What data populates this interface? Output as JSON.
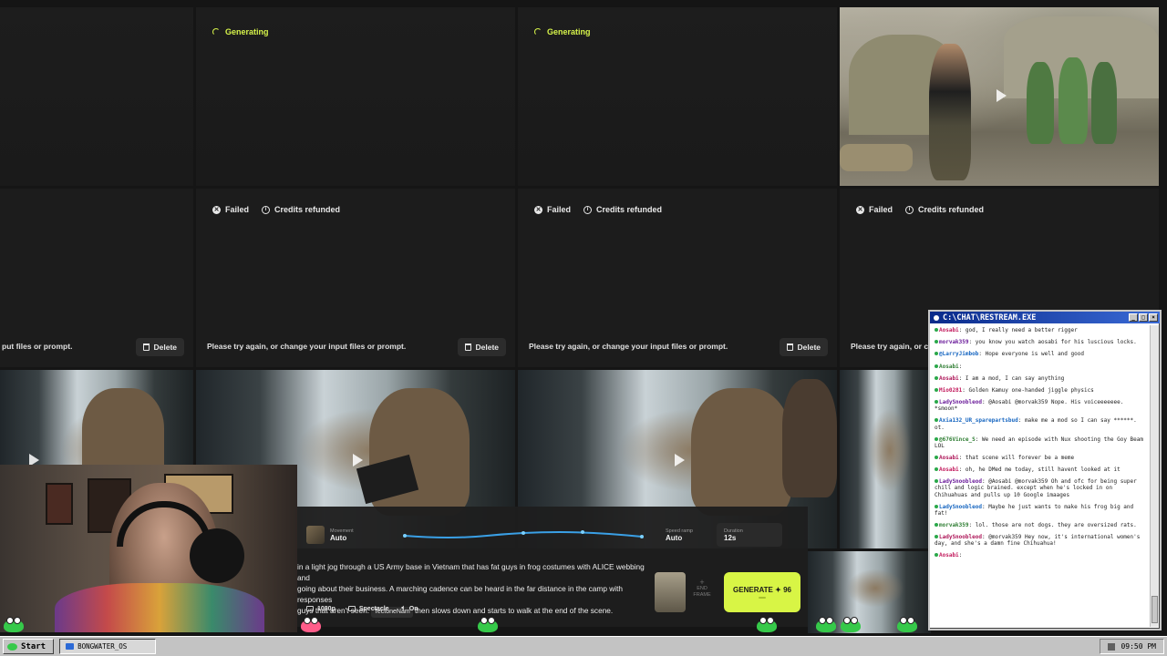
{
  "tiles_row1": {
    "generating_label": "Generating"
  },
  "tiles_row2": {
    "failed_label": "Failed",
    "refunded_label": "Credits refunded",
    "retry_text": "Please try again, or change your input files or prompt.",
    "retry_text_partial_left": "put files or prompt.",
    "retry_text_partial_right": "Please try again, or char",
    "delete_label": "Delete"
  },
  "panel": {
    "movement_label": "Movement",
    "movement_value": "Auto",
    "speed_label": "Speed ramp",
    "speed_value": "Auto",
    "duration_label": "Duration",
    "duration_value": "12s",
    "prompt_line1": "in a light jog through a US Army base in Vietnam that has fat guys in frog costumes with ALICE webbing and",
    "prompt_line2": "going about their business. A marching cadence can be heard in the far distance in the camp with responses",
    "prompt_line3_a": "guys that aren't seen.",
    "prompt_tag": "TectoneNam",
    "prompt_line3_b": "then slows down and starts to walk at the end of the scene.",
    "opt_resolution": "1080p",
    "opt_style": "Spectacle",
    "opt_sound": "On",
    "end_frame": "END FRAME",
    "generate_label": "GENERATE",
    "generate_cost": "96"
  },
  "chat": {
    "title": "C:\\CHAT\\RESTREAM.EXE",
    "messages": [
      {
        "user": "Aosabi",
        "text": "god, I really need a better rigger"
      },
      {
        "user": "morvak359",
        "text": "you know you watch aosabi for his luscious locks."
      },
      {
        "user": "@LarryJimbob",
        "text": "Hope everyone is well and good"
      },
      {
        "user": "Aosabi",
        "text": ""
      },
      {
        "user": "Aosabi",
        "text": "I am a mod, I can say anything"
      },
      {
        "user": "Mio0281",
        "text": "Golden Kamuy one-handed jiggle physics"
      },
      {
        "user": "LadySnoobleod",
        "text": "@Aosabi @morvak359 Nope. His voiceeeeeee. *smoon*"
      },
      {
        "user": "Axia132_UR_sparepartsbud",
        "text": "make me a mod so I can say ******. ot."
      },
      {
        "user": "@676Vince_S",
        "text": "We need an episode with Nux shooting the Goy Beam LOL"
      },
      {
        "user": "Aosabi",
        "text": "that scene will forever be a meme"
      },
      {
        "user": "Aosabi",
        "text": "oh, he DMed me today, still havent looked at it"
      },
      {
        "user": "LadySnoobleod",
        "text": "@Aosabi @morvak359 Oh and ofc for being super chill and logic brained. except when he's locked in on Chihuahuas and pulls up 10 Google imaages"
      },
      {
        "user": "LadySnoobleod",
        "text": "Maybe he just wants to make his frog big and fat!"
      },
      {
        "user": "morvak359",
        "text": "lol. those are not dogs. they are oversized rats."
      },
      {
        "user": "LadySnoobleod",
        "text": "@morvak359 Hey now, it's international women's day, and she's a damn fine Chihuahua!"
      },
      {
        "user": "Aosabi",
        "text": ""
      }
    ]
  },
  "taskbar": {
    "start_label": "Start",
    "task_label": "BONGWATER_OS",
    "clock": "09:50 PM"
  }
}
